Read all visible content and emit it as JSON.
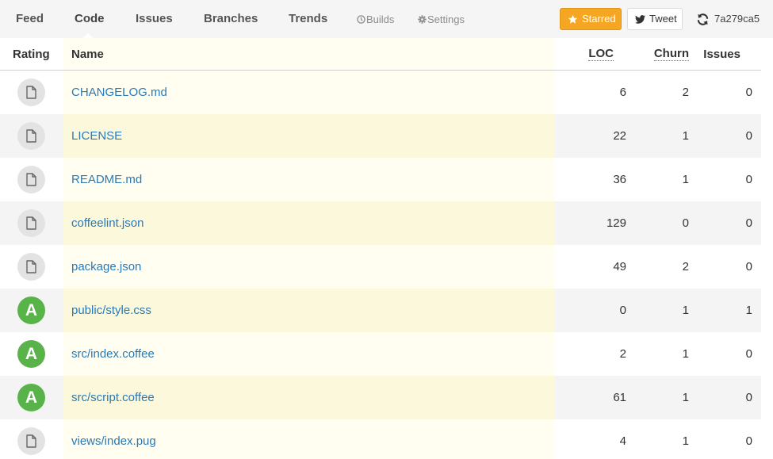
{
  "nav": {
    "tabs": [
      {
        "label": "Feed"
      },
      {
        "label": "Code"
      },
      {
        "label": "Issues"
      },
      {
        "label": "Branches"
      },
      {
        "label": "Trends"
      }
    ],
    "builds_label": "Builds",
    "settings_label": "Settings",
    "active_tab": "Code"
  },
  "actions": {
    "starred_label": "Starred",
    "tweet_label": "Tweet",
    "commit_sha": "7a279ca5"
  },
  "table": {
    "headers": {
      "rating": "Rating",
      "name": "Name",
      "loc": "LOC",
      "churn": "Churn",
      "issues": "Issues"
    },
    "rows": [
      {
        "rating": "",
        "name": "CHANGELOG.md",
        "loc": "6",
        "churn": "2",
        "issues": "0"
      },
      {
        "rating": "",
        "name": "LICENSE",
        "loc": "22",
        "churn": "1",
        "issues": "0"
      },
      {
        "rating": "",
        "name": "README.md",
        "loc": "36",
        "churn": "1",
        "issues": "0"
      },
      {
        "rating": "",
        "name": "coffeelint.json",
        "loc": "129",
        "churn": "0",
        "issues": "0"
      },
      {
        "rating": "",
        "name": "package.json",
        "loc": "49",
        "churn": "2",
        "issues": "0"
      },
      {
        "rating": "A",
        "name": "public/style.css",
        "loc": "0",
        "churn": "1",
        "issues": "1"
      },
      {
        "rating": "A",
        "name": "src/index.coffee",
        "loc": "2",
        "churn": "1",
        "issues": "0"
      },
      {
        "rating": "A",
        "name": "src/script.coffee",
        "loc": "61",
        "churn": "1",
        "issues": "0"
      },
      {
        "rating": "",
        "name": "views/index.pug",
        "loc": "4",
        "churn": "1",
        "issues": "0"
      }
    ]
  },
  "colors": {
    "grade_a": "#5ab34a",
    "starred": "#f5a623",
    "link": "#2a7ab8"
  }
}
